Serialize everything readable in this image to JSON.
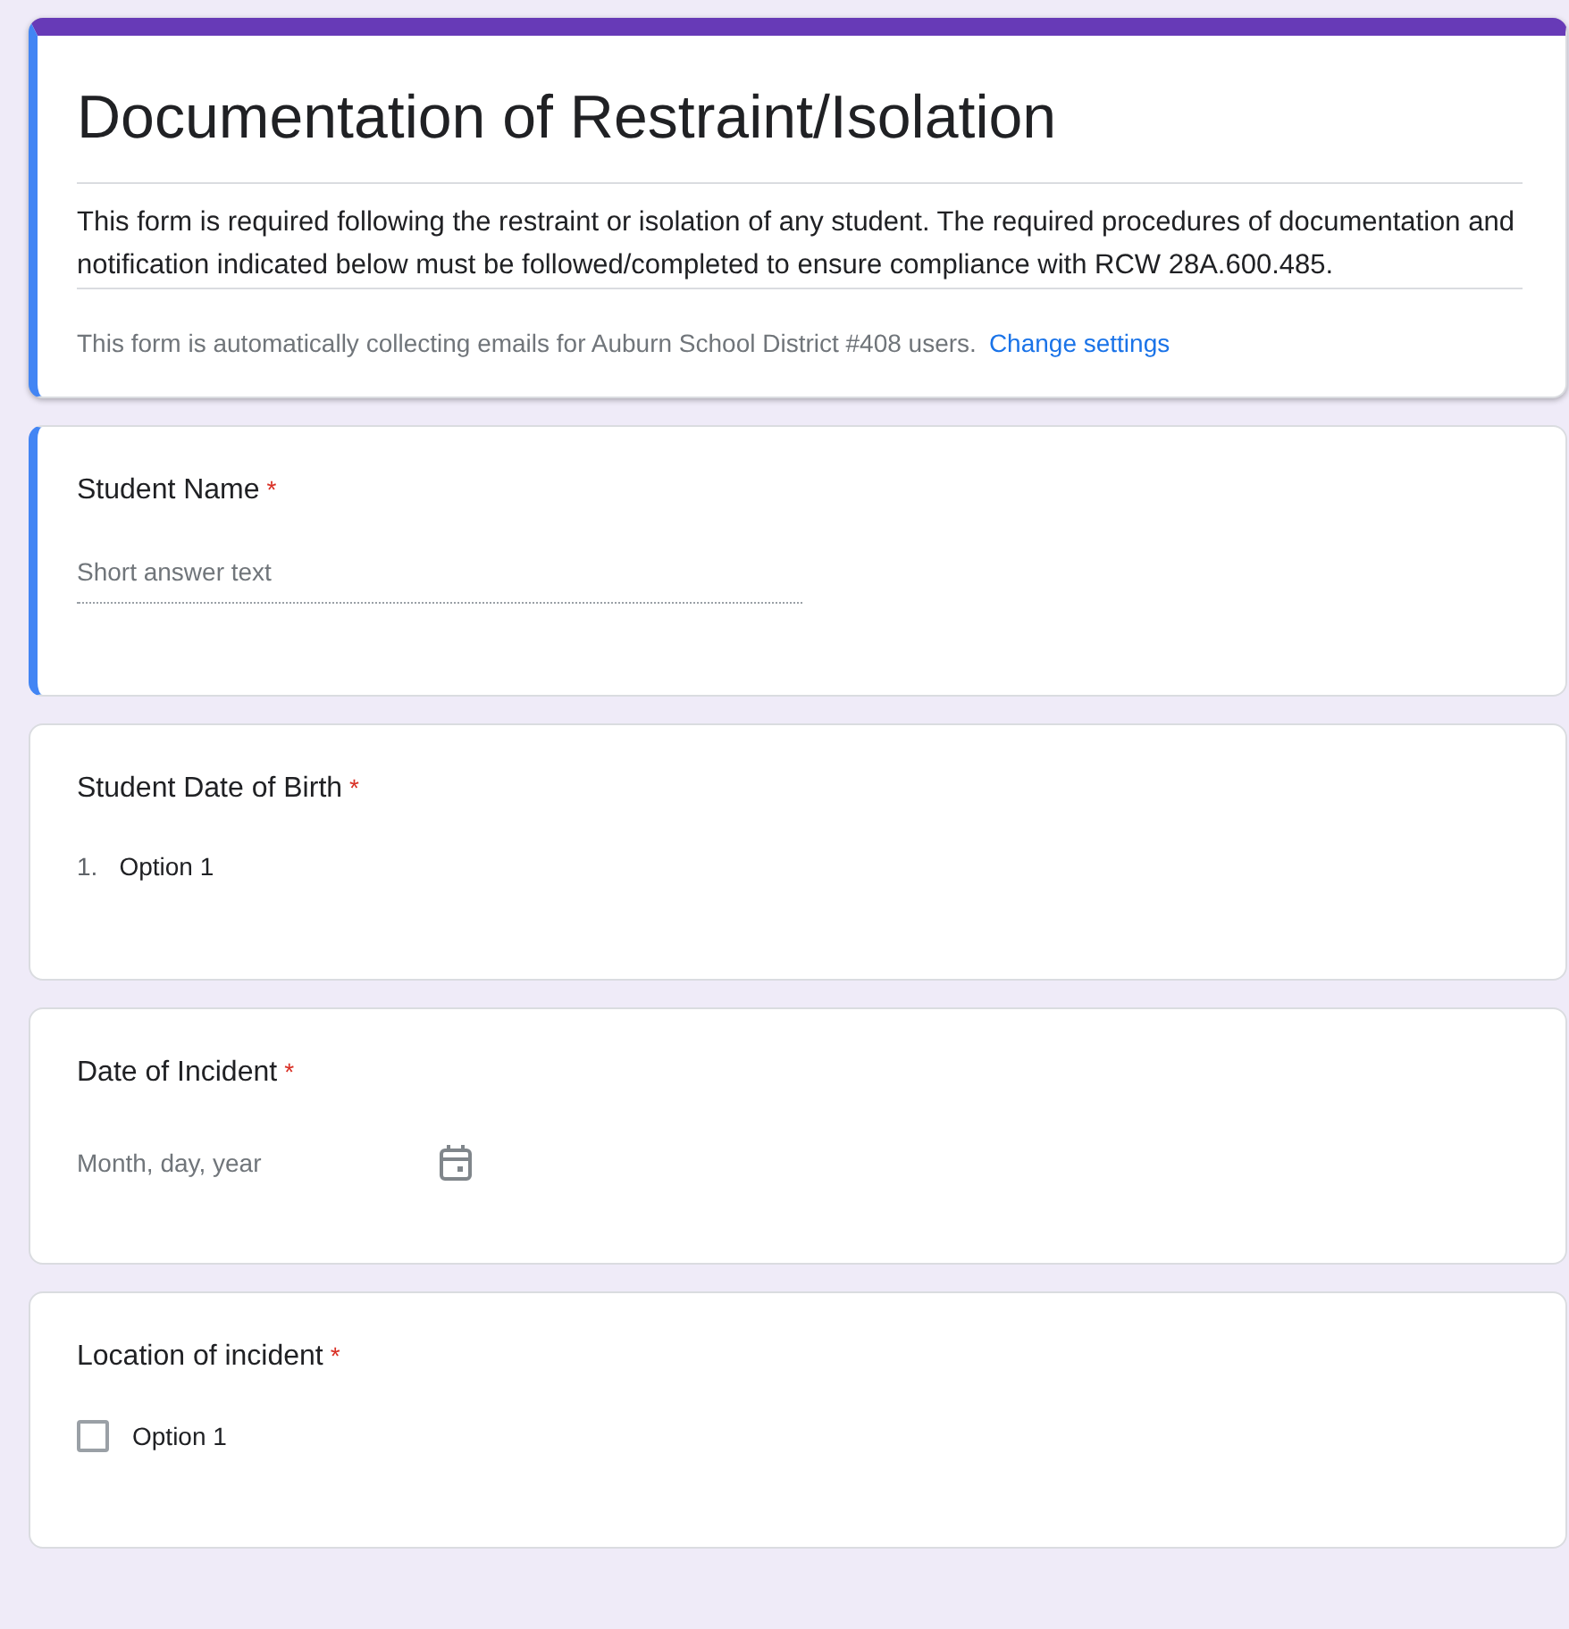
{
  "header": {
    "title": "Documentation of Restraint/Isolation",
    "selected": true,
    "description": "This form is required following the restraint or isolation of any student. The required procedures of documentation and notification indicated below must be followed/completed to ensure compliance with RCW 28A.600.485.",
    "notice": "This form is automatically collecting emails for Auburn School District #408 users.",
    "notice_link": "Change settings"
  },
  "questions": [
    {
      "kind": "short",
      "title": "Student Name",
      "required_mark": "*",
      "selected": true,
      "placeholder": "Short answer text"
    },
    {
      "kind": "numbered",
      "title": "Student Date of Birth",
      "required_mark": "*",
      "selected": false,
      "number": "1.",
      "option": "Option 1"
    },
    {
      "kind": "date",
      "title": "Date of Incident",
      "required_mark": "*",
      "selected": false,
      "placeholder": "Month, day, year"
    },
    {
      "kind": "checkbox",
      "title": "Location of incident",
      "required_mark": "*",
      "selected": false,
      "option": "Option 1",
      "checked": false
    }
  ]
}
